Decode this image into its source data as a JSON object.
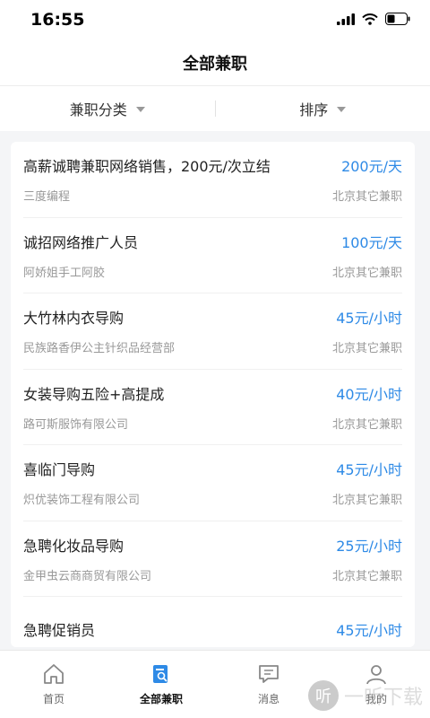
{
  "status": {
    "time": "16:55"
  },
  "header": {
    "title": "全部兼职"
  },
  "filters": [
    {
      "label": "兼职分类"
    },
    {
      "label": "排序"
    }
  ],
  "jobs": [
    {
      "title": "高薪诚聘兼职网络销售，200元/次立结",
      "salary": "200元/天",
      "company": "三度编程",
      "location": "北京其它兼职"
    },
    {
      "title": "诚招网络推广人员",
      "salary": "100元/天",
      "company": "阿娇姐手工阿胶",
      "location": "北京其它兼职"
    },
    {
      "title": "大竹林内衣导购",
      "salary": "45元/小时",
      "company": "民族路香伊公主针织品经营部",
      "location": "北京其它兼职"
    },
    {
      "title": "女装导购五险+高提成",
      "salary": "40元/小时",
      "company": "路可斯服饰有限公司",
      "location": "北京其它兼职"
    },
    {
      "title": "喜临门导购",
      "salary": "45元/小时",
      "company": "炽优装饰工程有限公司",
      "location": "北京其它兼职"
    },
    {
      "title": "急聘化妆品导购",
      "salary": "25元/小时",
      "company": "金甲虫云商商贸有限公司",
      "location": "北京其它兼职"
    },
    {
      "title": "急聘促销员",
      "salary": "45元/小时",
      "company": "",
      "location": ""
    }
  ],
  "tabs": [
    {
      "label": "首页",
      "icon": "home-icon"
    },
    {
      "label": "全部兼职",
      "icon": "job-search-icon"
    },
    {
      "label": "消息",
      "icon": "message-icon"
    },
    {
      "label": "我的",
      "icon": "profile-icon"
    }
  ],
  "watermark": {
    "text": "一听下载"
  },
  "colors": {
    "accent": "#2e8ae6",
    "tab_active": "#2e8ae6"
  }
}
